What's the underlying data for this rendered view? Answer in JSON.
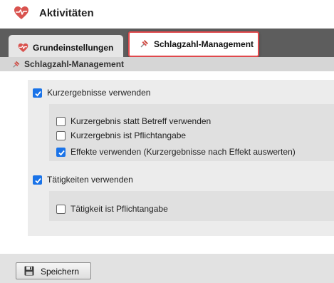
{
  "header": {
    "title": "Aktivitäten",
    "icon": "heart-pulse-icon",
    "accent": "#d9534f"
  },
  "tabs": [
    {
      "label": "Grundeinstellungen",
      "icon": "heart-pulse-icon",
      "active": false
    },
    {
      "label": "Schlagzahl-Management",
      "icon": "pushpin-icon",
      "active": true
    }
  ],
  "section": {
    "title": "Schlagzahl-Management",
    "icon": "pushpin-icon"
  },
  "options": {
    "kurzergebnisse": {
      "label": "Kurzergebnisse verwenden",
      "checked": true
    },
    "statt_betreff": {
      "label": "Kurzergebnis statt Betreff verwenden",
      "checked": false
    },
    "pflichtangabe": {
      "label": "Kurzergebnis ist Pflichtangabe",
      "checked": false
    },
    "effekte": {
      "label": "Effekte verwenden (Kurzergebnisse nach Effekt auswerten)",
      "checked": true
    },
    "taetigkeiten": {
      "label": "Tätigkeiten verwenden",
      "checked": true
    },
    "taetigkeit_pflicht": {
      "label": "Tätigkeit ist Pflichtangabe",
      "checked": false
    }
  },
  "footer": {
    "save_label": "Speichern",
    "save_icon": "floppy-disk-icon"
  },
  "colors": {
    "tabbar": "#5d5d5d",
    "checkbox": "#1a73e8",
    "highlight": "#e0484c"
  }
}
